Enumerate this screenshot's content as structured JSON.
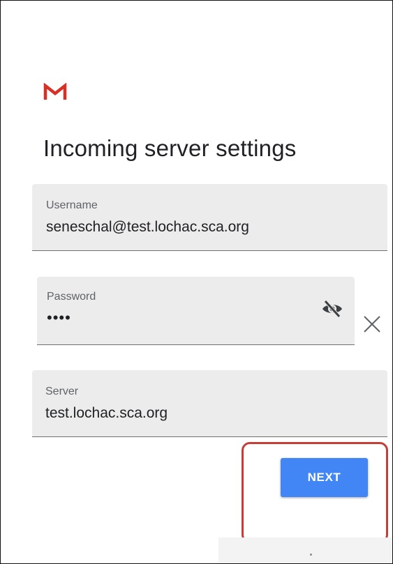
{
  "screen": {
    "title": "Incoming server settings"
  },
  "icons": {
    "logo": "gmail-m-logo",
    "password_toggle": "eye-off-icon",
    "clear": "close-icon"
  },
  "fields": {
    "username": {
      "label": "Username",
      "value": "seneschal@test.lochac.sca.org"
    },
    "password": {
      "label": "Password",
      "value": "••••"
    },
    "server": {
      "label": "Server",
      "value": "test.lochac.sca.org"
    }
  },
  "actions": {
    "next_label": "NEXT"
  },
  "colors": {
    "accent": "#4285f4",
    "logo_red": "#d93025",
    "highlight": "#c63e38",
    "field_background": "#ececec"
  }
}
